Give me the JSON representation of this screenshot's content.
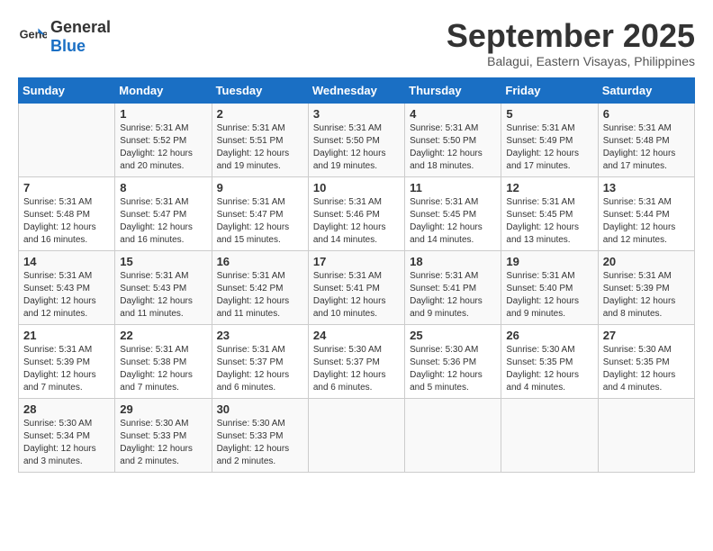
{
  "logo": {
    "general": "General",
    "blue": "Blue"
  },
  "title": "September 2025",
  "location": "Balagui, Eastern Visayas, Philippines",
  "days_of_week": [
    "Sunday",
    "Monday",
    "Tuesday",
    "Wednesday",
    "Thursday",
    "Friday",
    "Saturday"
  ],
  "weeks": [
    [
      {
        "day": "",
        "info": ""
      },
      {
        "day": "1",
        "info": "Sunrise: 5:31 AM\nSunset: 5:52 PM\nDaylight: 12 hours\nand 20 minutes."
      },
      {
        "day": "2",
        "info": "Sunrise: 5:31 AM\nSunset: 5:51 PM\nDaylight: 12 hours\nand 19 minutes."
      },
      {
        "day": "3",
        "info": "Sunrise: 5:31 AM\nSunset: 5:50 PM\nDaylight: 12 hours\nand 19 minutes."
      },
      {
        "day": "4",
        "info": "Sunrise: 5:31 AM\nSunset: 5:50 PM\nDaylight: 12 hours\nand 18 minutes."
      },
      {
        "day": "5",
        "info": "Sunrise: 5:31 AM\nSunset: 5:49 PM\nDaylight: 12 hours\nand 17 minutes."
      },
      {
        "day": "6",
        "info": "Sunrise: 5:31 AM\nSunset: 5:48 PM\nDaylight: 12 hours\nand 17 minutes."
      }
    ],
    [
      {
        "day": "7",
        "info": "Sunrise: 5:31 AM\nSunset: 5:48 PM\nDaylight: 12 hours\nand 16 minutes."
      },
      {
        "day": "8",
        "info": "Sunrise: 5:31 AM\nSunset: 5:47 PM\nDaylight: 12 hours\nand 16 minutes."
      },
      {
        "day": "9",
        "info": "Sunrise: 5:31 AM\nSunset: 5:47 PM\nDaylight: 12 hours\nand 15 minutes."
      },
      {
        "day": "10",
        "info": "Sunrise: 5:31 AM\nSunset: 5:46 PM\nDaylight: 12 hours\nand 14 minutes."
      },
      {
        "day": "11",
        "info": "Sunrise: 5:31 AM\nSunset: 5:45 PM\nDaylight: 12 hours\nand 14 minutes."
      },
      {
        "day": "12",
        "info": "Sunrise: 5:31 AM\nSunset: 5:45 PM\nDaylight: 12 hours\nand 13 minutes."
      },
      {
        "day": "13",
        "info": "Sunrise: 5:31 AM\nSunset: 5:44 PM\nDaylight: 12 hours\nand 12 minutes."
      }
    ],
    [
      {
        "day": "14",
        "info": "Sunrise: 5:31 AM\nSunset: 5:43 PM\nDaylight: 12 hours\nand 12 minutes."
      },
      {
        "day": "15",
        "info": "Sunrise: 5:31 AM\nSunset: 5:43 PM\nDaylight: 12 hours\nand 11 minutes."
      },
      {
        "day": "16",
        "info": "Sunrise: 5:31 AM\nSunset: 5:42 PM\nDaylight: 12 hours\nand 11 minutes."
      },
      {
        "day": "17",
        "info": "Sunrise: 5:31 AM\nSunset: 5:41 PM\nDaylight: 12 hours\nand 10 minutes."
      },
      {
        "day": "18",
        "info": "Sunrise: 5:31 AM\nSunset: 5:41 PM\nDaylight: 12 hours\nand 9 minutes."
      },
      {
        "day": "19",
        "info": "Sunrise: 5:31 AM\nSunset: 5:40 PM\nDaylight: 12 hours\nand 9 minutes."
      },
      {
        "day": "20",
        "info": "Sunrise: 5:31 AM\nSunset: 5:39 PM\nDaylight: 12 hours\nand 8 minutes."
      }
    ],
    [
      {
        "day": "21",
        "info": "Sunrise: 5:31 AM\nSunset: 5:39 PM\nDaylight: 12 hours\nand 7 minutes."
      },
      {
        "day": "22",
        "info": "Sunrise: 5:31 AM\nSunset: 5:38 PM\nDaylight: 12 hours\nand 7 minutes."
      },
      {
        "day": "23",
        "info": "Sunrise: 5:31 AM\nSunset: 5:37 PM\nDaylight: 12 hours\nand 6 minutes."
      },
      {
        "day": "24",
        "info": "Sunrise: 5:30 AM\nSunset: 5:37 PM\nDaylight: 12 hours\nand 6 minutes."
      },
      {
        "day": "25",
        "info": "Sunrise: 5:30 AM\nSunset: 5:36 PM\nDaylight: 12 hours\nand 5 minutes."
      },
      {
        "day": "26",
        "info": "Sunrise: 5:30 AM\nSunset: 5:35 PM\nDaylight: 12 hours\nand 4 minutes."
      },
      {
        "day": "27",
        "info": "Sunrise: 5:30 AM\nSunset: 5:35 PM\nDaylight: 12 hours\nand 4 minutes."
      }
    ],
    [
      {
        "day": "28",
        "info": "Sunrise: 5:30 AM\nSunset: 5:34 PM\nDaylight: 12 hours\nand 3 minutes."
      },
      {
        "day": "29",
        "info": "Sunrise: 5:30 AM\nSunset: 5:33 PM\nDaylight: 12 hours\nand 2 minutes."
      },
      {
        "day": "30",
        "info": "Sunrise: 5:30 AM\nSunset: 5:33 PM\nDaylight: 12 hours\nand 2 minutes."
      },
      {
        "day": "",
        "info": ""
      },
      {
        "day": "",
        "info": ""
      },
      {
        "day": "",
        "info": ""
      },
      {
        "day": "",
        "info": ""
      }
    ]
  ]
}
